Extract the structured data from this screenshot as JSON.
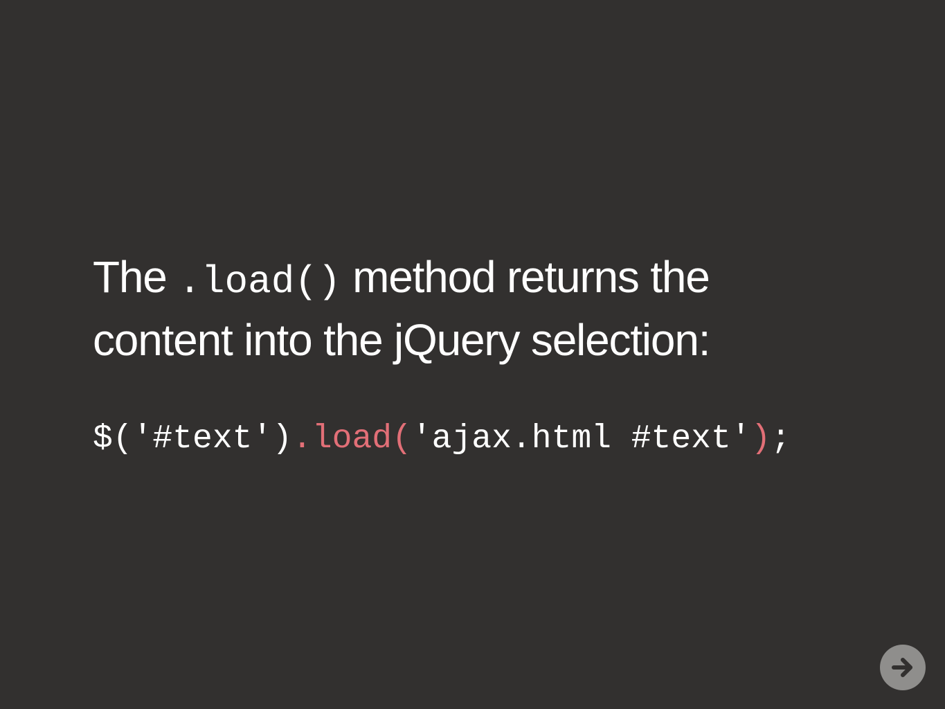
{
  "colors": {
    "background": "#32302f",
    "text": "#ffffff",
    "accent": "#e26f77",
    "button_bg": "#8f8e8c",
    "button_icon": "#32302f"
  },
  "slide": {
    "heading": {
      "prefix": "The ",
      "code": ".load()",
      "suffix_line1": " method returns the",
      "line2": "content into the jQuery selection:"
    },
    "code": {
      "part1": "$('#text')",
      "part2": ".load(",
      "part3": "'ajax.html #text'",
      "part4": ")",
      "part5": ";"
    }
  },
  "navigation": {
    "next_icon": "arrow-right-icon"
  }
}
